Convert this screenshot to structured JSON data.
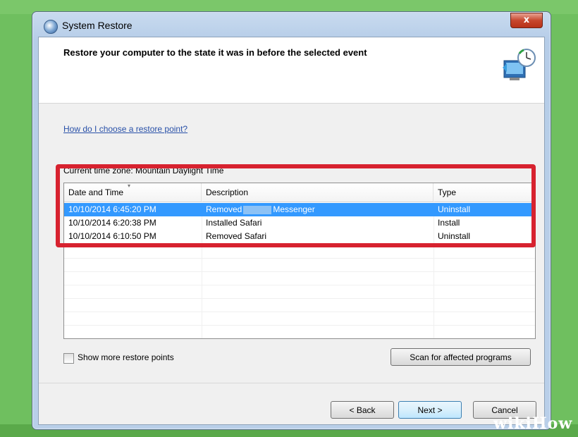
{
  "window": {
    "title": "System Restore",
    "close_label": "x"
  },
  "header": {
    "title": "Restore your computer to the state it was in before the selected event"
  },
  "help_link": "How do I choose a restore point?",
  "timezone_text": "Current time zone: Mountain Daylight Time",
  "table": {
    "columns": [
      "Date and Time",
      "Description",
      "Type"
    ],
    "rows": [
      {
        "date": "10/10/2014 6:45:20 PM",
        "desc_prefix": "Removed",
        "desc_suffix": "Messenger",
        "type": "Uninstall"
      },
      {
        "date": "10/10/2014 6:20:38 PM",
        "description": "Installed Safari",
        "type": "Install"
      },
      {
        "date": "10/10/2014 6:10:50 PM",
        "description": "Removed Safari",
        "type": "Uninstall"
      }
    ],
    "selected_row": 0
  },
  "checkbox": {
    "label": "Show more restore points",
    "checked": false
  },
  "buttons": {
    "scan": "Scan for affected programs",
    "back": "< Back",
    "next": "Next >",
    "cancel": "Cancel"
  },
  "watermark": "wikiHow",
  "colors": {
    "highlight": "#d7222f",
    "selection": "#3399ff",
    "link": "#2850a8"
  },
  "icons": {
    "title_icon": "system-restore-icon",
    "header_graphic": "restore-clock-icon"
  }
}
